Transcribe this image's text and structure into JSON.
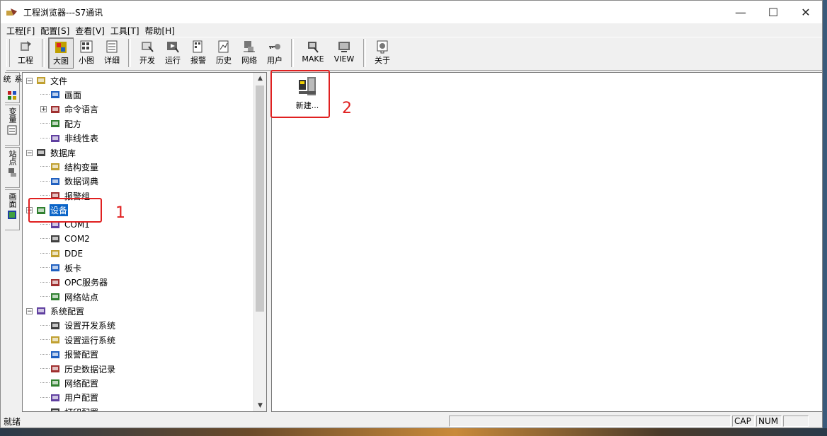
{
  "window": {
    "title": "工程浏览器---S7通讯",
    "controls": [
      "—",
      "☐",
      "✕"
    ]
  },
  "menu": [
    "工程[F]",
    "配置[S]",
    "查看[V]",
    "工具[T]",
    "帮助[H]"
  ],
  "toolbar": [
    {
      "label": "工程",
      "icon": "project-icon"
    },
    {
      "label": "大图",
      "icon": "large-icon-view-icon",
      "active": true
    },
    {
      "label": "小图",
      "icon": "small-icon-view-icon"
    },
    {
      "label": "详细",
      "icon": "details-view-icon"
    },
    {
      "label": "开发",
      "icon": "develop-icon"
    },
    {
      "label": "运行",
      "icon": "run-icon"
    },
    {
      "label": "报警",
      "icon": "alarm-icon"
    },
    {
      "label": "历史",
      "icon": "history-icon"
    },
    {
      "label": "网络",
      "icon": "network-icon"
    },
    {
      "label": "用户",
      "icon": "user-key-icon"
    },
    {
      "label": "MAKE",
      "icon": "make-icon"
    },
    {
      "label": "VIEW",
      "icon": "view-icon"
    },
    {
      "label": "关于",
      "icon": "about-icon"
    }
  ],
  "side_tabs": [
    "系统",
    "变量",
    "站点",
    "画面"
  ],
  "tree": [
    {
      "label": "文件",
      "level": 0,
      "expander": "−",
      "icon": "folder-icon"
    },
    {
      "label": "画面",
      "level": 1,
      "icon": "screen-icon"
    },
    {
      "label": "命令语言",
      "level": 1,
      "expander": "+",
      "icon": "command-language-icon"
    },
    {
      "label": "配方",
      "level": 1,
      "icon": "recipe-icon"
    },
    {
      "label": "非线性表",
      "level": 1,
      "icon": "nonlinear-table-icon"
    },
    {
      "label": "数据库",
      "level": 0,
      "expander": "−",
      "icon": "database-icon"
    },
    {
      "label": "结构变量",
      "level": 1,
      "icon": "struct-variable-icon"
    },
    {
      "label": "数据词典",
      "level": 1,
      "icon": "data-dictionary-icon"
    },
    {
      "label": "报警组",
      "level": 1,
      "icon": "alarm-group-icon"
    },
    {
      "label": "设备",
      "level": 0,
      "expander": "−",
      "icon": "device-icon",
      "selected": true
    },
    {
      "label": "COM1",
      "level": 1,
      "icon": "com-port-icon"
    },
    {
      "label": "COM2",
      "level": 1,
      "icon": "com-port-icon"
    },
    {
      "label": "DDE",
      "level": 1,
      "icon": "dde-icon"
    },
    {
      "label": "板卡",
      "level": 1,
      "icon": "board-card-icon"
    },
    {
      "label": "OPC服务器",
      "level": 1,
      "icon": "opc-server-icon"
    },
    {
      "label": "网络站点",
      "level": 1,
      "icon": "network-station-icon"
    },
    {
      "label": "系统配置",
      "level": 0,
      "expander": "−",
      "icon": "tools-icon"
    },
    {
      "label": "设置开发系统",
      "level": 1,
      "icon": "dev-settings-icon"
    },
    {
      "label": "设置运行系统",
      "level": 1,
      "icon": "run-settings-icon"
    },
    {
      "label": "报警配置",
      "level": 1,
      "icon": "alarm-config-icon"
    },
    {
      "label": "历史数据记录",
      "level": 1,
      "icon": "history-record-icon"
    },
    {
      "label": "网络配置",
      "level": 1,
      "icon": "network-config-icon"
    },
    {
      "label": "用户配置",
      "level": 1,
      "icon": "user-config-icon"
    },
    {
      "label": "打印配置",
      "level": 1,
      "icon": "print-config-icon"
    }
  ],
  "content": {
    "new_item_label": "新建..."
  },
  "annotations": {
    "one": "1",
    "two": "2"
  },
  "status": {
    "text": "就绪",
    "cap": "CAP",
    "num": "NUM"
  },
  "colors": {
    "highlight": "#e02020",
    "selection": "#0a64c8"
  }
}
